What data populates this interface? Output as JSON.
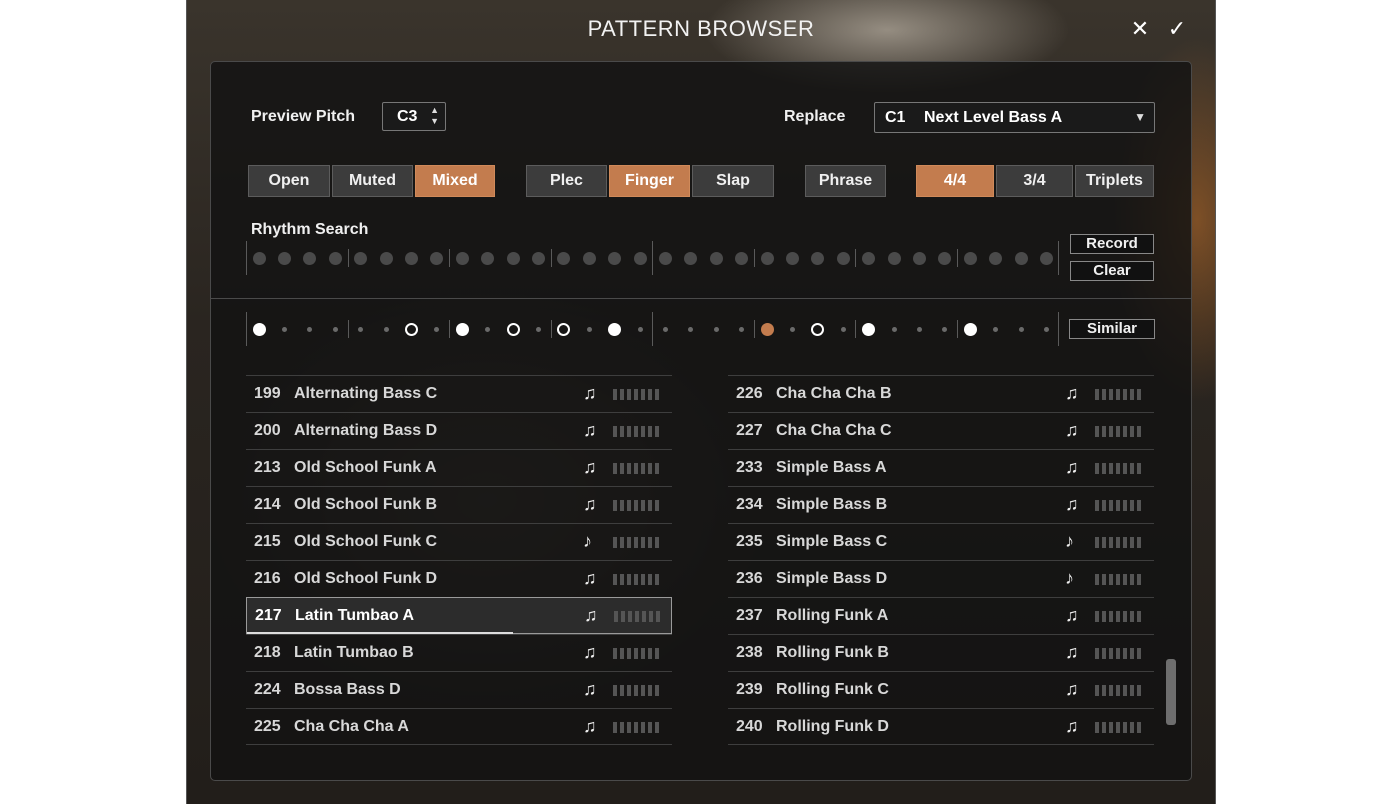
{
  "window": {
    "title": "PATTERN BROWSER",
    "close_icon": "close-icon",
    "confirm_icon": "check-icon"
  },
  "controls": {
    "preview_pitch_label": "Preview Pitch",
    "preview_pitch_value": "C3",
    "replace_label": "Replace",
    "replace_key": "C1",
    "replace_name": "Next Level Bass A"
  },
  "filters": {
    "articulation": [
      {
        "label": "Open",
        "on": false
      },
      {
        "label": "Muted",
        "on": false
      },
      {
        "label": "Mixed",
        "on": true
      }
    ],
    "technique": [
      {
        "label": "Plec",
        "on": false
      },
      {
        "label": "Finger",
        "on": true
      },
      {
        "label": "Slap",
        "on": false
      }
    ],
    "phrase": {
      "label": "Phrase",
      "on": false
    },
    "meter": [
      {
        "label": "4/4",
        "on": true
      },
      {
        "label": "3/4",
        "on": false
      },
      {
        "label": "Triplets",
        "on": false
      }
    ]
  },
  "rhythm_search": {
    "label": "Rhythm Search",
    "record_label": "Record",
    "clear_label": "Clear",
    "steps": 32
  },
  "pattern": {
    "similar_label": "Similar",
    "steps": [
      "big",
      "small",
      "small",
      "small",
      "small",
      "small",
      "ring",
      "small",
      "big",
      "small",
      "ring",
      "small",
      "ring",
      "small",
      "big",
      "small",
      "small",
      "small",
      "small",
      "small",
      "accent",
      "small",
      "ring",
      "small",
      "big",
      "small",
      "small",
      "small",
      "big",
      "small",
      "small",
      "small"
    ]
  },
  "colors": {
    "accent": "#c37c4e"
  },
  "list_left": [
    {
      "num": "199",
      "name": "Alternating Bass C",
      "icon": "eighth-notes-icon"
    },
    {
      "num": "200",
      "name": "Alternating Bass D",
      "icon": "eighth-notes-icon"
    },
    {
      "num": "213",
      "name": "Old School Funk A",
      "icon": "eighth-notes-icon"
    },
    {
      "num": "214",
      "name": "Old School Funk B",
      "icon": "eighth-notes-icon"
    },
    {
      "num": "215",
      "name": "Old School Funk C",
      "icon": "eighth-note-icon"
    },
    {
      "num": "216",
      "name": "Old School Funk D",
      "icon": "eighth-notes-icon"
    },
    {
      "num": "217",
      "name": "Latin Tumbao A",
      "icon": "eighth-notes-icon",
      "selected": true
    },
    {
      "num": "218",
      "name": "Latin Tumbao B",
      "icon": "eighth-notes-icon"
    },
    {
      "num": "224",
      "name": "Bossa Bass D",
      "icon": "eighth-notes-icon"
    },
    {
      "num": "225",
      "name": "Cha Cha Cha A",
      "icon": "eighth-notes-icon"
    }
  ],
  "list_right": [
    {
      "num": "226",
      "name": "Cha Cha Cha B",
      "icon": "eighth-notes-icon"
    },
    {
      "num": "227",
      "name": "Cha Cha Cha C",
      "icon": "eighth-notes-icon"
    },
    {
      "num": "233",
      "name": "Simple Bass A",
      "icon": "eighth-notes-icon"
    },
    {
      "num": "234",
      "name": "Simple Bass B",
      "icon": "eighth-notes-icon"
    },
    {
      "num": "235",
      "name": "Simple Bass C",
      "icon": "eighth-note-icon"
    },
    {
      "num": "236",
      "name": "Simple Bass D",
      "icon": "eighth-note-icon"
    },
    {
      "num": "237",
      "name": "Rolling Funk A",
      "icon": "eighth-notes-icon"
    },
    {
      "num": "238",
      "name": "Rolling Funk B",
      "icon": "eighth-notes-icon"
    },
    {
      "num": "239",
      "name": "Rolling Funk C",
      "icon": "eighth-notes-icon"
    },
    {
      "num": "240",
      "name": "Rolling Funk D",
      "icon": "eighth-notes-icon"
    }
  ]
}
